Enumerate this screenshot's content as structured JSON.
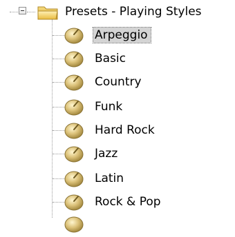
{
  "tree": {
    "root": {
      "label": "Presets - Playing Styles",
      "expanded": true,
      "icon": "folder-icon"
    },
    "items": [
      {
        "label": "Arpeggio",
        "selected": true,
        "icon": "dial-icon"
      },
      {
        "label": "Basic",
        "selected": false,
        "icon": "dial-icon"
      },
      {
        "label": "Country",
        "selected": false,
        "icon": "dial-icon"
      },
      {
        "label": "Funk",
        "selected": false,
        "icon": "dial-icon"
      },
      {
        "label": "Hard Rock",
        "selected": false,
        "icon": "dial-icon"
      },
      {
        "label": "Jazz",
        "selected": false,
        "icon": "dial-icon"
      },
      {
        "label": "Latin",
        "selected": false,
        "icon": "dial-icon"
      },
      {
        "label": "Rock & Pop",
        "selected": false,
        "icon": "dial-icon"
      }
    ],
    "colors": {
      "selection_bg": "#d4d4d4",
      "folder_yellow": "#f3d36a",
      "dial_gold": "#c9ae5e"
    }
  }
}
